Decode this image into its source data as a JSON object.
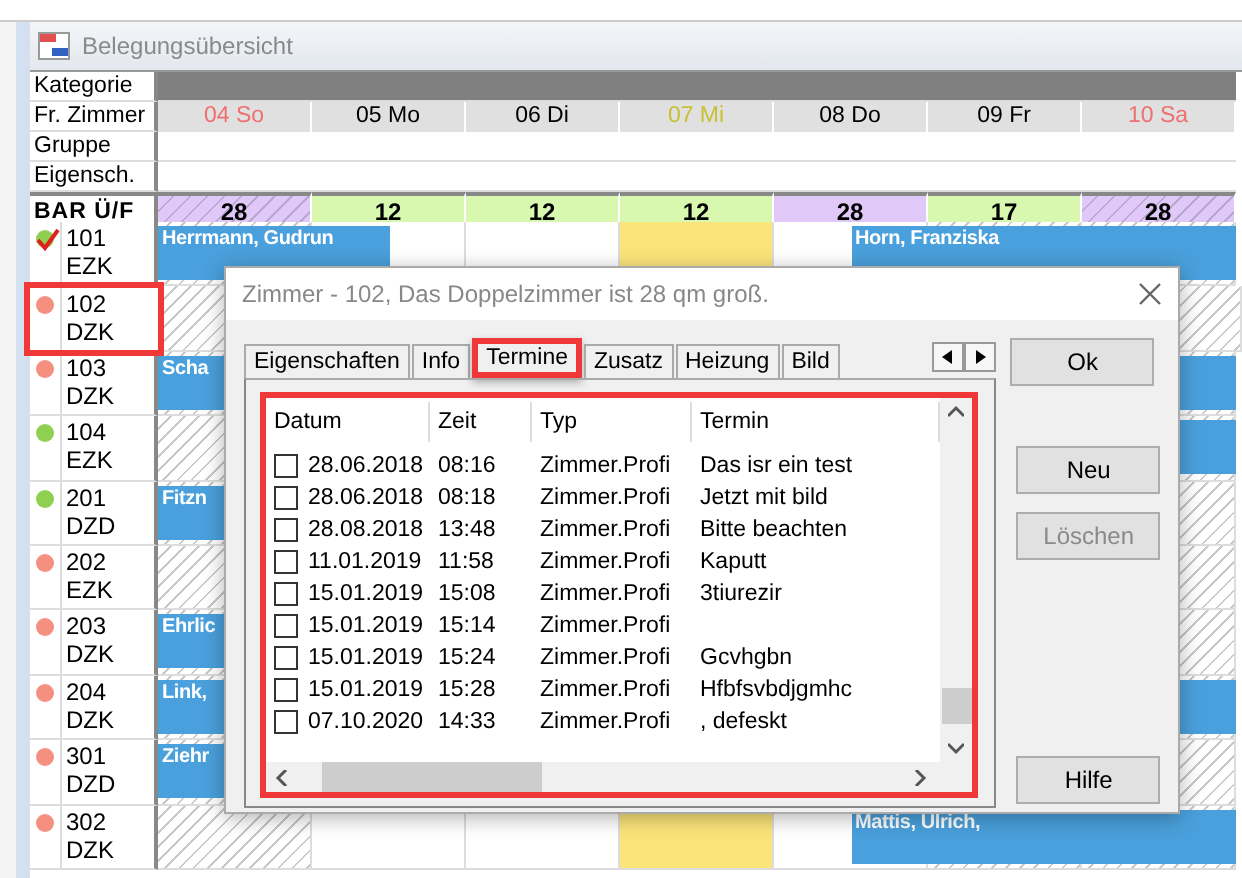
{
  "window": {
    "title": "Belegungsübersicht"
  },
  "header_labels": {
    "category": "Kategorie",
    "free_rooms": "Fr. Zimmer",
    "group": "Gruppe",
    "properties": "Eigensch.",
    "rate": "BAR Ü/F"
  },
  "days": [
    {
      "label": "04 So",
      "color": "#f07070",
      "kind": "hatched",
      "rate": {
        "text": "28",
        "color": "#e0c8f8",
        "hatched": true
      }
    },
    {
      "label": "05 Mo",
      "color": "#000000",
      "kind": "plain",
      "rate": {
        "text": "12",
        "color": "#d8f8b0",
        "hatched": false
      }
    },
    {
      "label": "06 Di",
      "color": "#000000",
      "kind": "plain",
      "rate": {
        "text": "12",
        "color": "#d8f8b0",
        "hatched": false
      }
    },
    {
      "label": "07 Mi",
      "color": "#c8c030",
      "kind": "today",
      "rate": {
        "text": "12",
        "color": "#d8f8b0",
        "hatched": false
      }
    },
    {
      "label": "08 Do",
      "color": "#000000",
      "kind": "plain",
      "rate": {
        "text": "28",
        "color": "#e0c8f8",
        "hatched": false
      }
    },
    {
      "label": "09 Fr",
      "color": "#000000",
      "kind": "hatched",
      "rate": {
        "text": "17",
        "color": "#d8f8b0",
        "hatched": false
      }
    },
    {
      "label": "10 Sa",
      "color": "#f07070",
      "kind": "hatched",
      "rate": {
        "text": "28",
        "color": "#e0c8f8",
        "hatched": true
      }
    }
  ],
  "rooms": [
    {
      "number": "101",
      "type": "EZK",
      "color": "#90d050",
      "checked": true,
      "highlighted": false,
      "bookings": [
        {
          "name": "Herrmann, Gudrun",
          "kind": "week_start"
        },
        {
          "name": "Horn, Franziska",
          "kind": "week_end"
        }
      ]
    },
    {
      "number": "102",
      "type": "DZK",
      "color": "#f49080",
      "checked": false,
      "highlighted": true
    },
    {
      "number": "103",
      "type": "DZK",
      "color": "#f49080",
      "checked": false,
      "highlighted": false,
      "bookings": [
        {
          "name": "Scha",
          "kind": "week_start"
        },
        {
          "kind": "week_end"
        }
      ]
    },
    {
      "number": "104",
      "type": "EZK",
      "color": "#90d050",
      "checked": false,
      "highlighted": false,
      "bookings": [
        {
          "kind": "week_end"
        }
      ]
    },
    {
      "number": "201",
      "type": "DZD",
      "color": "#90d050",
      "checked": false,
      "highlighted": false,
      "bookings": [
        {
          "name": "Fitzn",
          "kind": "week_start"
        }
      ]
    },
    {
      "number": "202",
      "type": "EZK",
      "color": "#f49080",
      "checked": false,
      "highlighted": false
    },
    {
      "number": "203",
      "type": "DZK",
      "color": "#f49080",
      "checked": false,
      "highlighted": false,
      "bookings": [
        {
          "name": "Ehrlic",
          "kind": "week_start"
        }
      ]
    },
    {
      "number": "204",
      "type": "DZK",
      "color": "#f49080",
      "checked": false,
      "highlighted": false,
      "bookings": [
        {
          "name": "Link,",
          "kind": "week_start"
        },
        {
          "kind": "week_end"
        }
      ]
    },
    {
      "number": "301",
      "type": "DZD",
      "color": "#f49080",
      "checked": false,
      "highlighted": false,
      "bookings": [
        {
          "name": "Ziehr",
          "kind": "week_start"
        }
      ]
    },
    {
      "number": "302",
      "type": "DZK",
      "color": "#f49080",
      "checked": false,
      "highlighted": false,
      "bookings": [
        {
          "name": "Mattis, Ulrich,",
          "kind": "week_end"
        }
      ]
    }
  ],
  "dialog": {
    "title": "Zimmer - 102, Das Doppelzimmer ist 28 qm groß.",
    "tabs": [
      {
        "label": "Eigenschaften",
        "selected": false,
        "highlighted": false
      },
      {
        "label": "Info",
        "selected": false,
        "highlighted": false
      },
      {
        "label": "Termine",
        "selected": true,
        "highlighted": true
      },
      {
        "label": "Zusatz",
        "selected": false,
        "highlighted": false
      },
      {
        "label": "Heizung",
        "selected": false,
        "highlighted": false
      },
      {
        "label": "Bild",
        "selected": false,
        "highlighted": false
      }
    ],
    "list": {
      "highlighted": true,
      "columns": [
        "Datum",
        "Zeit",
        "Typ",
        "Termin"
      ],
      "rows": [
        {
          "checked": false,
          "date": "28.06.2018",
          "time": "08:16",
          "type": "Zimmer.Profi",
          "note": "Das isr ein test"
        },
        {
          "checked": false,
          "date": "28.06.2018",
          "time": "08:18",
          "type": "Zimmer.Profi",
          "note": "Jetzt mit bild"
        },
        {
          "checked": false,
          "date": "28.08.2018",
          "time": "13:48",
          "type": "Zimmer.Profi",
          "note": "Bitte beachten"
        },
        {
          "checked": false,
          "date": "11.01.2019",
          "time": "11:58",
          "type": "Zimmer.Profi",
          "note": "Kaputt"
        },
        {
          "checked": false,
          "date": "15.01.2019",
          "time": "15:08",
          "type": "Zimmer.Profi",
          "note": "3tiurezir"
        },
        {
          "checked": false,
          "date": "15.01.2019",
          "time": "15:14",
          "type": "Zimmer.Profi"
        },
        {
          "checked": false,
          "date": "15.01.2019",
          "time": "15:24",
          "type": "Zimmer.Profi",
          "note": "Gcvhgbn"
        },
        {
          "checked": false,
          "date": "15.01.2019",
          "time": "15:28",
          "type": "Zimmer.Profi",
          "note": "Hfbfsvbdjgmhc"
        },
        {
          "checked": false,
          "date": "07.10.2020",
          "time": "14:33",
          "type": "Zimmer.Profi",
          "note": ", defeskt"
        }
      ]
    },
    "buttons": [
      {
        "label": "Ok",
        "disabled": false,
        "kind": "top"
      },
      {
        "label": "Neu",
        "disabled": false,
        "kind": "middle"
      },
      {
        "label": "Löschen",
        "disabled": true,
        "kind": "middle"
      },
      {
        "label": "Hilfe",
        "disabled": false,
        "kind": "bottom"
      }
    ]
  }
}
